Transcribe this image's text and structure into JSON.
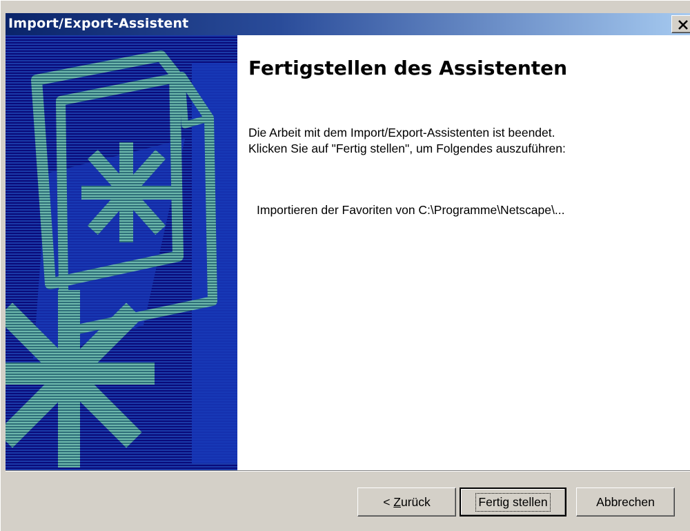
{
  "window": {
    "title": "Import/Export-Assistent",
    "close_icon": "close-x-icon"
  },
  "side_image": {
    "icon": "wizard-folder-asterisk-graphic",
    "colors": {
      "background": "#0a0a7a",
      "accent": "#5aa9a0",
      "stripe": "#1e3aa8"
    }
  },
  "main": {
    "heading": "Fertigstellen des Assistenten",
    "paragraph_line1": "Die Arbeit mit dem Import/Export-Assistenten ist beendet.",
    "paragraph_line2": "Klicken Sie auf \"Fertig stellen\", um Folgendes auszuführen:",
    "action_item": "Importieren der Favoriten von C:\\Programme\\Netscape\\..."
  },
  "buttons": {
    "back_prefix": "< ",
    "back_mnemonic": "Z",
    "back_rest": "urück",
    "finish": "Fertig stellen",
    "cancel": "Abbrechen"
  }
}
